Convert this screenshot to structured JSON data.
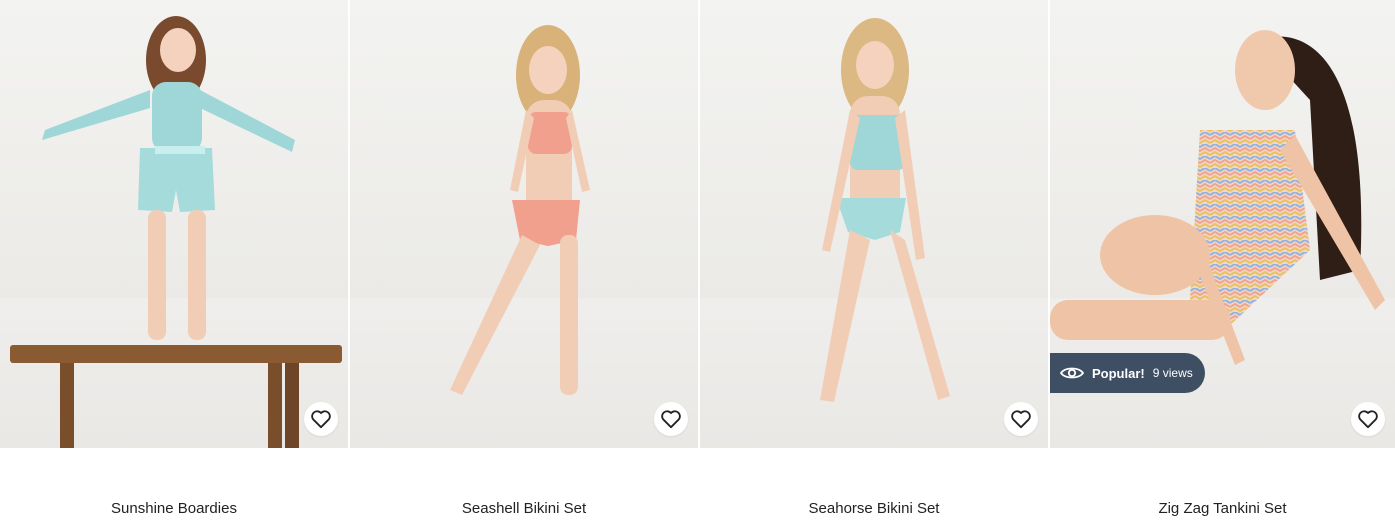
{
  "products": [
    {
      "name": "Sunshine Boardies",
      "wishlist_icon": "heart-outline-icon"
    },
    {
      "name": "Seashell Bikini Set",
      "wishlist_icon": "heart-outline-icon"
    },
    {
      "name": "Seahorse Bikini Set",
      "wishlist_icon": "heart-outline-icon"
    },
    {
      "name": "Zig Zag Tankini Set",
      "wishlist_icon": "heart-outline-icon",
      "badge": {
        "icon": "eye-icon",
        "label": "Popular!",
        "views": "9 views"
      }
    }
  ],
  "colors": {
    "badge_bg": "#3e4f63",
    "aqua": "#9fd6d8",
    "coral": "#f2a08e",
    "text": "#222222"
  }
}
